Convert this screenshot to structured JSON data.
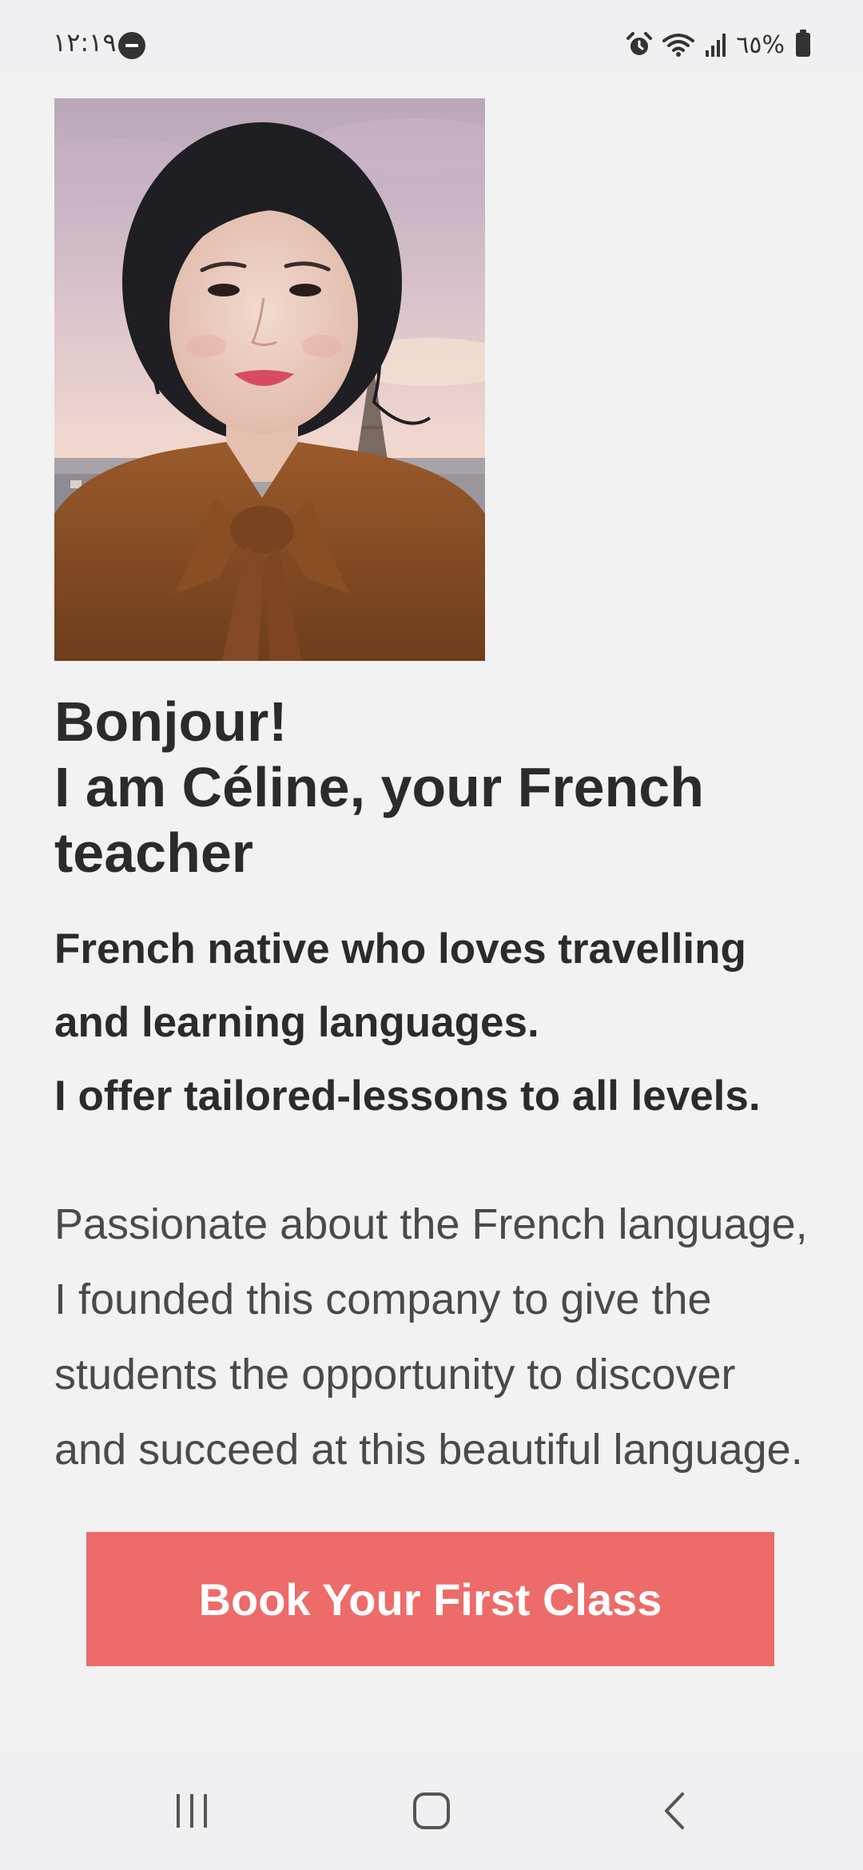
{
  "status_bar": {
    "time": "١٢:١٩",
    "battery": "٦٥%",
    "icons": [
      "do-not-disturb-icon",
      "alarm-icon",
      "wifi-icon",
      "signal-icon",
      "battery-icon"
    ]
  },
  "hero": {
    "photo_icon": "teacher-portrait-photo"
  },
  "headline": {
    "line1": "Bonjour!",
    "line2": "I am Céline, your French",
    "line3": "teacher"
  },
  "subheadline": {
    "line1": "French native who loves travelling",
    "line2": "and learning languages.",
    "line3": "I offer tailored-lessons to all levels."
  },
  "description": {
    "line1": "Passionate about the French language,",
    "line2": "I founded this company to give the",
    "line3": "students the opportunity to discover",
    "line4": "and succeed at this beautiful language."
  },
  "cta": {
    "label": "Book Your First Class",
    "color": "#ed6b69"
  },
  "nav_bar": {
    "icons": [
      "recent-apps-icon",
      "home-icon",
      "back-icon"
    ]
  }
}
